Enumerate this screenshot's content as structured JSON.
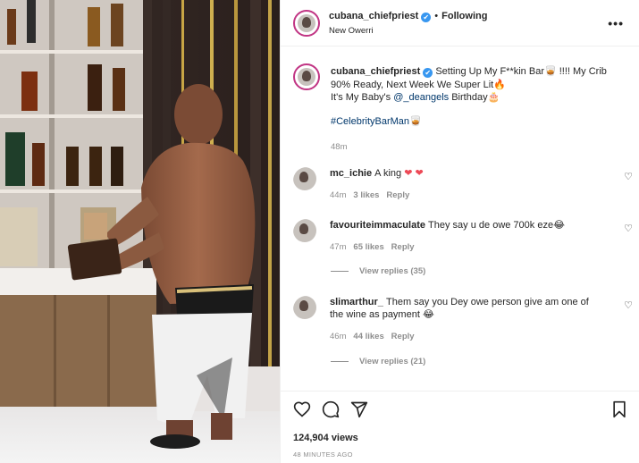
{
  "post": {
    "author": "cubana_chiefpriest",
    "verified": "✔",
    "separator": "•",
    "follow_status": "Following",
    "location": "New Owerri",
    "more": "•••"
  },
  "caption": {
    "username": "cubana_chiefpriest",
    "text_line1": " Setting Up My F**kin Bar🥃 !!!! My Crib 90% Ready, Next Week We Super Lit🔥",
    "text_line2_prefix": "It's My Baby's ",
    "mention": "@_deangels",
    "text_line2_suffix": " Birthday🎂",
    "hashtag": "#CelebrityBarMan🥃",
    "time": "48m"
  },
  "comments": [
    {
      "username": "mc_ichie",
      "text": "A king ",
      "emoji": "❤ ❤",
      "time": "44m",
      "likes": "3 likes",
      "reply": "Reply"
    },
    {
      "username": "favouriteimmaculate",
      "text": "They say u de owe 700k eze😂",
      "time": "47m",
      "likes": "65 likes",
      "reply": "Reply",
      "view_replies": "View replies (35)"
    },
    {
      "username": "slimarthur_",
      "text": "Them say you Dey owe person give am one of the wine as payment 😂",
      "time": "46m",
      "likes": "44 likes",
      "reply": "Reply",
      "view_replies": "View replies (21)"
    }
  ],
  "footer": {
    "views": "124,904 views",
    "time_ago": "48 MINUTES AGO"
  },
  "icons": {
    "heart": "heart-icon",
    "comment": "comment-icon",
    "share": "share-icon",
    "save": "bookmark-icon"
  },
  "colors": {
    "link": "#00376b",
    "verified": "#3897f0",
    "like_red": "#ed4956",
    "muted": "#8e8e8e"
  }
}
